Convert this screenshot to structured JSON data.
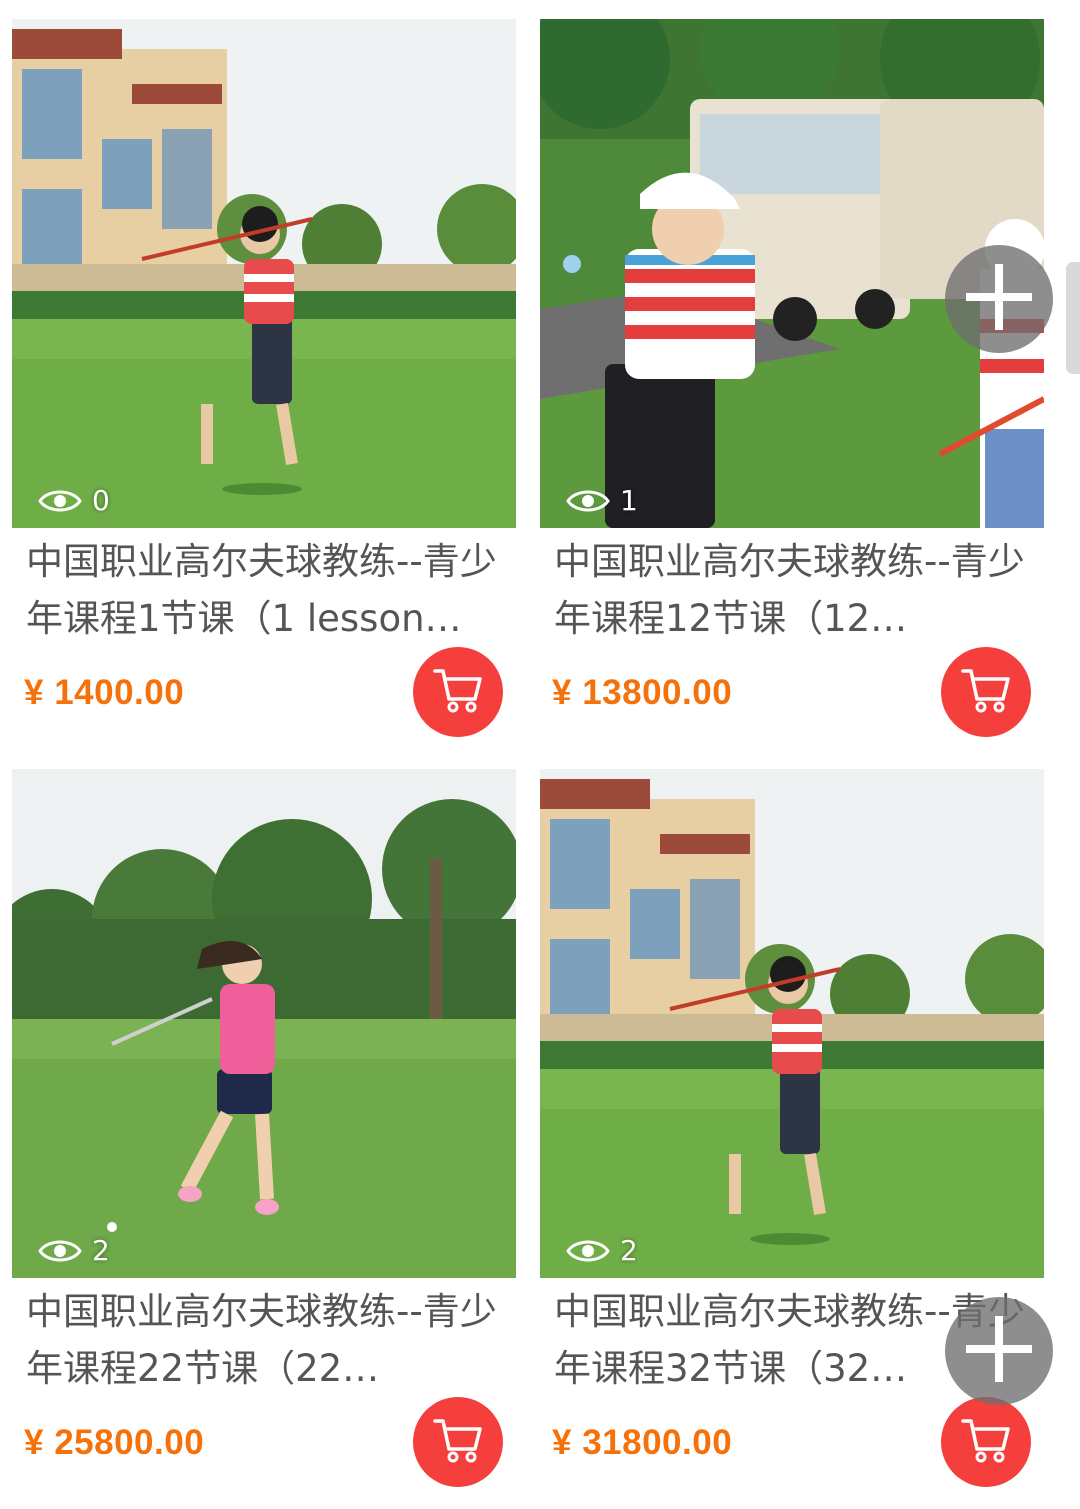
{
  "products": [
    {
      "title": "中国职业高尔夫球教练--青少年课程1节课（1 lesson…",
      "price": "¥ 1400.00",
      "views": "0",
      "image": "boy-golf-swing-in-front-of-villa"
    },
    {
      "title": "中国职业高尔夫球教练--青少年课程12节课（12…",
      "price": "¥ 13800.00",
      "views": "1",
      "image": "boy-with-cap-holding-ball-near-golf-carts"
    },
    {
      "title": "中国职业高尔夫球教练--青少年课程22节课（22…",
      "price": "¥ 25800.00",
      "views": "2",
      "image": "girl-in-pink-golf-swing-on-course"
    },
    {
      "title": "中国职业高尔夫球教练--青少年课程32节课（32…",
      "price": "¥ 31800.00",
      "views": "2",
      "image": "boy-golf-swing-in-front-of-villa"
    }
  ],
  "icons": {
    "views": "eye-icon",
    "cart": "shopping-cart-icon",
    "fab": "plus-icon"
  },
  "colors": {
    "price": "#f5710b",
    "cart_button": "#f43f3c",
    "title": "#555555",
    "fab": "#6e6e6e"
  }
}
